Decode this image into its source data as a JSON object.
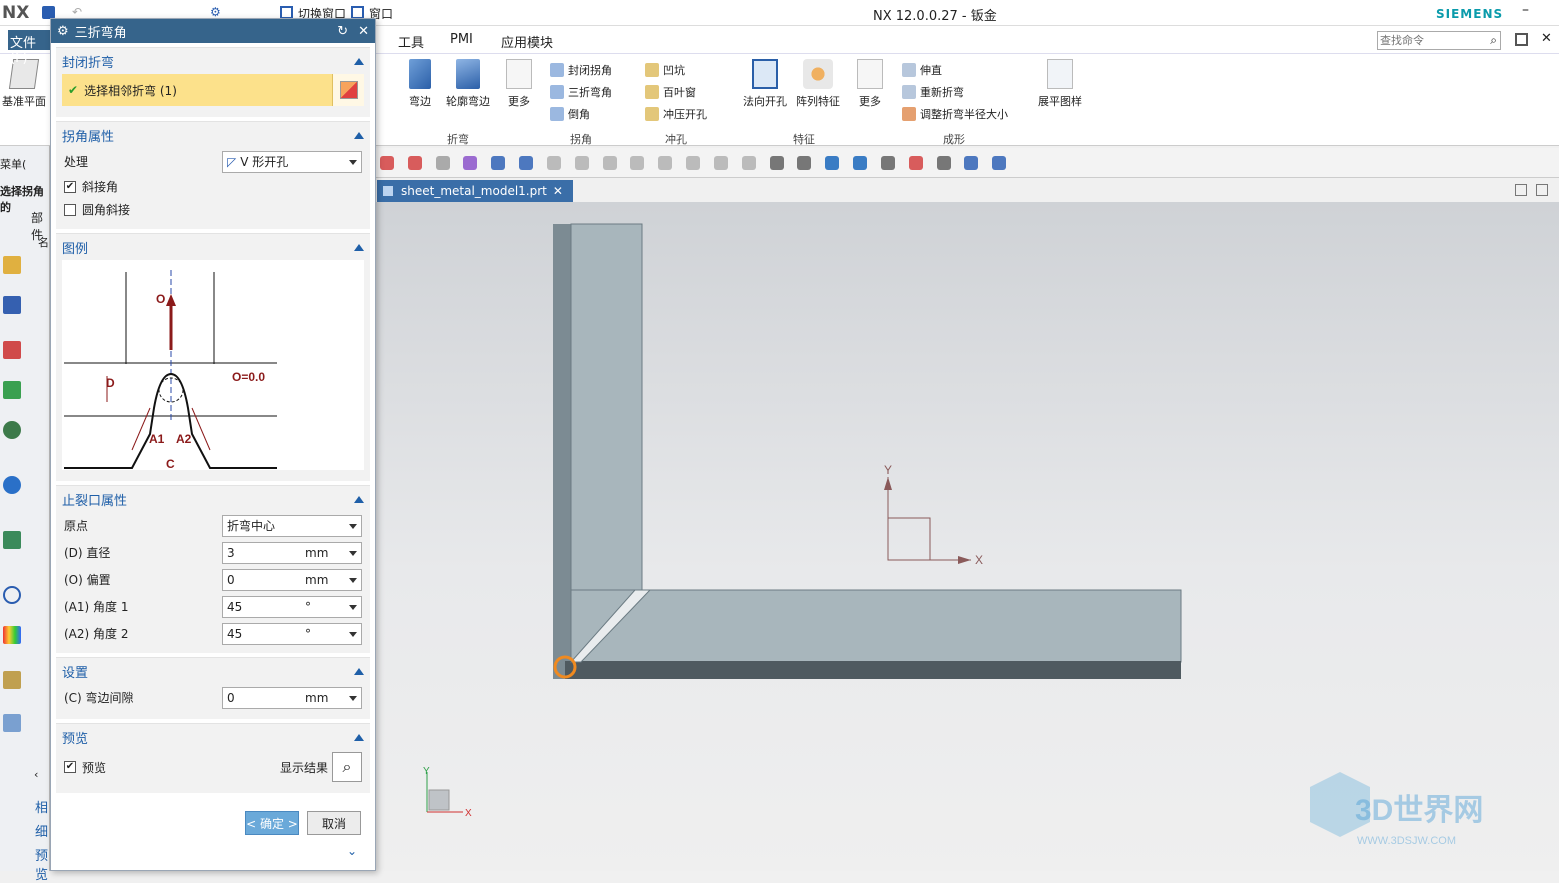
{
  "app": {
    "logo": "NX",
    "title": "NX 12.0.0.27 - 钣金",
    "brand": "SIEMENS",
    "switch_window": "切换窗口",
    "window_menu": "窗口"
  },
  "menu": {
    "file": "文件(F)",
    "tools": "工具",
    "pmi": "PMI",
    "app_modules": "应用模块",
    "search_placeholder": "查找命令"
  },
  "ribbon": {
    "datum_plane": "基准平面",
    "flange": "弯边",
    "contour_flange": "轮廓弯边",
    "more1": "更多",
    "close_corner": "封闭拐角",
    "three_bend_corner": "三折弯角",
    "chamfer": "倒角",
    "dimple": "凹坑",
    "louver": "百叶窗",
    "drawn_cutout": "冲压开孔",
    "normal_cutout": "法向开孔",
    "pattern_feature": "阵列特征",
    "more2": "更多",
    "unbend": "伸直",
    "rebend": "重新折弯",
    "resize_bend_radius": "调整折弯半径大小",
    "flat_pattern": "展平图样",
    "group_bend": "折弯",
    "group_corner": "拐角",
    "group_punch": "冲孔",
    "group_feature": "特征",
    "group_form": "成形"
  },
  "left": {
    "menu": "菜单(",
    "select_corner": "选择拐角的",
    "part": "部件",
    "name": "名",
    "related": "相",
    "detail": "细",
    "preview": "预览"
  },
  "tab": {
    "filename": "sheet_metal_model1.prt"
  },
  "dialog": {
    "title": "三折弯角",
    "sec_close_bend": "封闭折弯",
    "select_bend": "选择相邻折弯 (1)",
    "sec_corner_props": "拐角属性",
    "treatment_label": "处理",
    "treatment_value": "V 形开孔",
    "miter_corner": "斜接角",
    "round_miter": "圆角斜接",
    "sec_legend": "图例",
    "sec_relief_props": "止裂口属性",
    "origin_label": "原点",
    "origin_value": "折弯中心",
    "diameter_label": "(D) 直径",
    "diameter_value": "3",
    "diameter_unit": "mm",
    "offset_label": "(O) 偏置",
    "offset_value": "0",
    "offset_unit": "mm",
    "angle1_label": "(A1) 角度 1",
    "angle1_value": "45",
    "angle1_unit": "°",
    "angle2_label": "(A2) 角度 2",
    "angle2_value": "45",
    "angle2_unit": "°",
    "sec_settings": "设置",
    "gap_label": "(C) 弯边间隙",
    "gap_value": "0",
    "gap_unit": "mm",
    "sec_preview": "预览",
    "preview_check": "预览",
    "show_result": "显示结果",
    "ok": "< 确定 >",
    "cancel": "取消"
  },
  "legend": {
    "o": "O",
    "d": "D",
    "o_eq": "O=0.0",
    "a1": "A1",
    "a2": "A2",
    "c": "C"
  },
  "axes": {
    "x": "X",
    "y": "Y"
  },
  "watermark": {
    "main": "3D世界网",
    "sub": "WWW.3DSJW.COM"
  }
}
